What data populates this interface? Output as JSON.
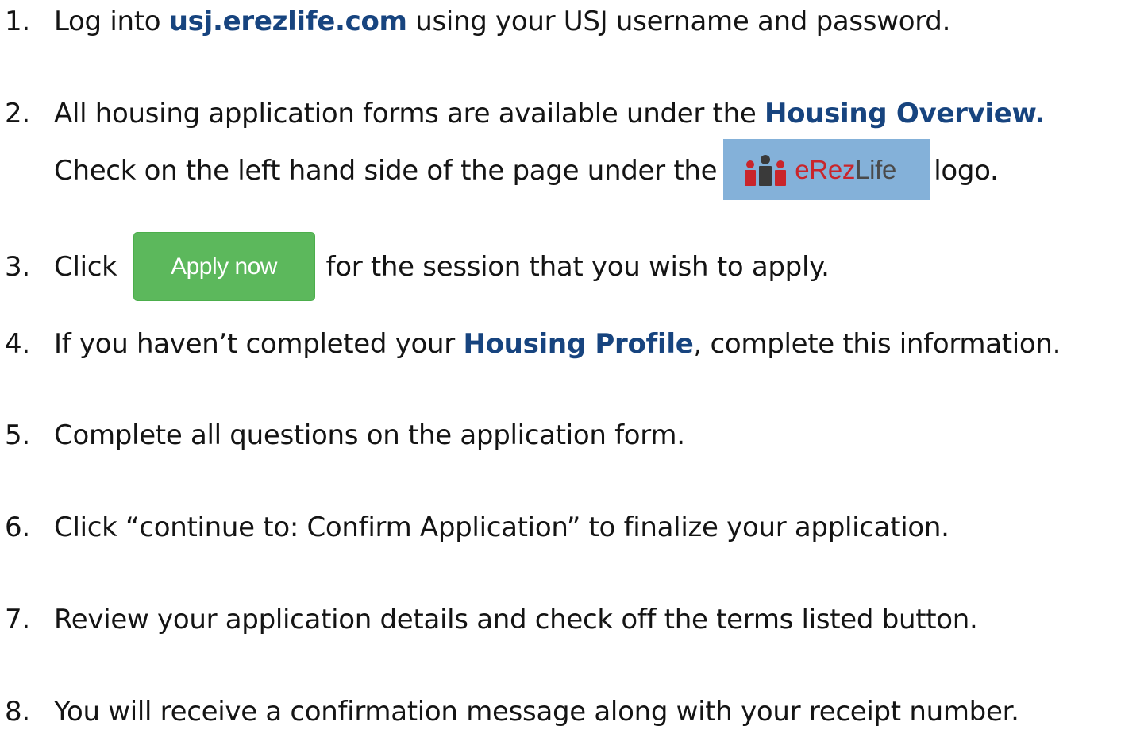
{
  "steps": [
    {
      "number": "1.",
      "before": "Log into ",
      "link": "usj.erezlife.com",
      "after": " using your USJ username and password."
    },
    {
      "number": "2.",
      "before": "All housing application forms are available under the ",
      "link": "Housing Overview.",
      "line2_before": "Check on the left hand side of the page under the",
      "line2_after": "logo."
    },
    {
      "number": "3.",
      "before": "Click",
      "after": "for the session that you wish to apply."
    },
    {
      "number": "4.",
      "before": "If you haven’t completed your ",
      "link": "Housing Profile",
      "after": ", complete this information."
    },
    {
      "number": "5.",
      "text": "Complete all questions on the application form."
    },
    {
      "number": "6.",
      "text": "Click “continue to: Confirm Application” to finalize your application."
    },
    {
      "number": "7.",
      "text": "Review your application details and check off the terms listed button."
    },
    {
      "number": "8.",
      "text": "You will receive a confirmation message along with your receipt number."
    }
  ],
  "logo": {
    "e": "e",
    "rez": "Rez",
    "life": "Life",
    "icon": "people-icon",
    "background": "#84b1d9",
    "red": "#c9252b"
  },
  "apply_button": {
    "label": "Apply now",
    "color": "#5cb85c"
  },
  "colors": {
    "link": "#17447f",
    "text": "#141414"
  }
}
